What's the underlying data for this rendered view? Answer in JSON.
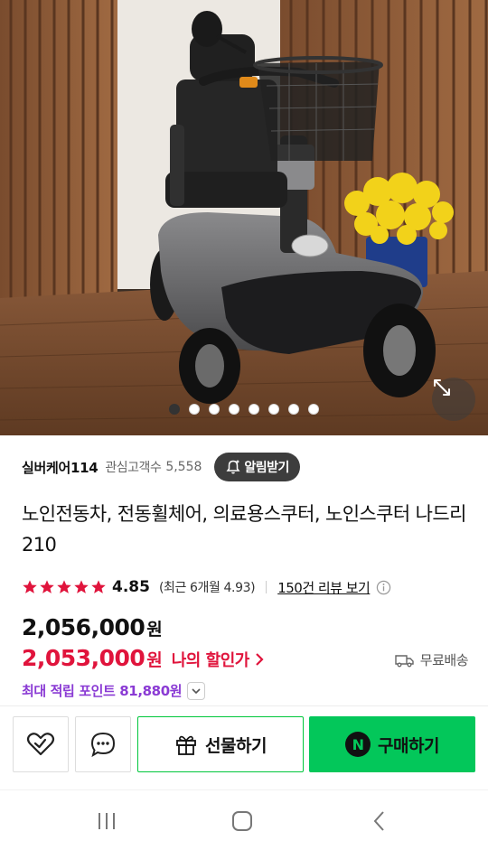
{
  "hero": {
    "image_description_icon": "mobility-scooter-photo",
    "carousel_total": 8,
    "carousel_active": 0,
    "zoom_icon": "expand-icon"
  },
  "store": {
    "name": "실버케어114",
    "follower_label": "관심고객수",
    "follower_count": "5,558",
    "notify_label": "알림받기"
  },
  "product": {
    "title": "노인전동차, 전동휠체어, 의료용스쿠터, 노인스쿠터 나드리210"
  },
  "rating": {
    "stars": 5,
    "value": "4.85",
    "recent": "(최근 6개월 4.93)",
    "review_link": "150건 리뷰 보기"
  },
  "price": {
    "original": "2,056,000",
    "original_unit": "원",
    "sale": "2,053,000",
    "sale_unit": "원",
    "discount_label": "나의 할인가",
    "shipping": "무료배송"
  },
  "points": {
    "label": "최대 적립 포인트 81,880원"
  },
  "actions": {
    "wish_icon": "heart-check-icon",
    "chat_icon": "chat-bubble-icon",
    "gift_label": "선물하기",
    "buy_label": "구매하기",
    "buy_badge": "N"
  },
  "colors": {
    "accent_green": "#03c75a",
    "sale_red": "#e0143c",
    "points_purple": "#8a3ad4",
    "star_red": "#e0143c"
  }
}
